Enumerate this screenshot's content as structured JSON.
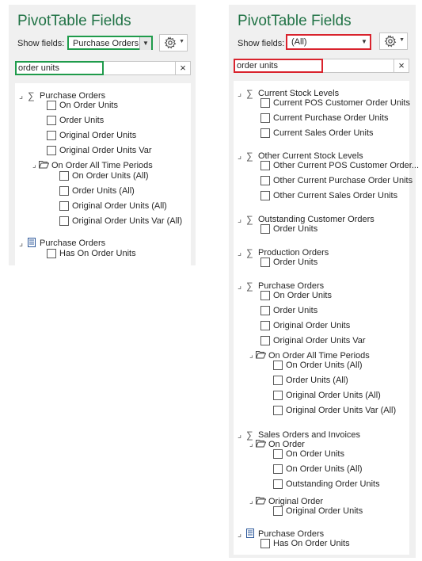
{
  "left": {
    "title": "PivotTable Fields",
    "show_fields_label": "Show fields:",
    "show_fields_value": "Purchase Orders",
    "highlight_color": "#1f9b4b",
    "search_value": "order units",
    "clear_label": "×",
    "tree": [
      {
        "type": "group",
        "icon": "sigma-icon",
        "label": "Purchase Orders"
      },
      {
        "type": "field",
        "label": "On Order Units"
      },
      {
        "type": "field",
        "label": "Order Units"
      },
      {
        "type": "field",
        "label": "Original Order Units"
      },
      {
        "type": "field",
        "label": "Original Order Units Var"
      },
      {
        "type": "folder",
        "icon": "folder-icon",
        "label": "On Order All Time Periods"
      },
      {
        "type": "field",
        "label": "On Order Units (All)"
      },
      {
        "type": "field",
        "label": "Order Units (All)"
      },
      {
        "type": "field",
        "label": "Original Order Units (All)"
      },
      {
        "type": "field",
        "label": "Original Order Units Var (All)"
      },
      {
        "type": "group",
        "icon": "table-icon",
        "label": "Purchase Orders"
      },
      {
        "type": "field",
        "label": "Has On Order Units"
      }
    ]
  },
  "right": {
    "title": "PivotTable Fields",
    "show_fields_label": "Show fields:",
    "show_fields_value": "(All)",
    "highlight_color": "#d9232d",
    "search_value": "order units",
    "clear_label": "×",
    "tree": [
      {
        "type": "group",
        "icon": "sigma-icon",
        "label": "Current Stock Levels"
      },
      {
        "type": "field",
        "label": "Current POS Customer Order Units"
      },
      {
        "type": "field",
        "label": "Current Purchase Order Units"
      },
      {
        "type": "field",
        "label": "Current Sales Order Units"
      },
      {
        "type": "group",
        "icon": "sigma-icon",
        "label": "Other Current Stock Levels"
      },
      {
        "type": "field",
        "label": "Other Current POS Customer Order..."
      },
      {
        "type": "field",
        "label": "Other Current Purchase Order Units"
      },
      {
        "type": "field",
        "label": "Other Current Sales Order Units"
      },
      {
        "type": "group",
        "icon": "sigma-icon",
        "label": "Outstanding Customer Orders"
      },
      {
        "type": "field",
        "label": "Order Units"
      },
      {
        "type": "group",
        "icon": "sigma-icon",
        "label": "Production Orders"
      },
      {
        "type": "field",
        "label": "Order Units"
      },
      {
        "type": "group",
        "icon": "sigma-icon",
        "label": "Purchase Orders"
      },
      {
        "type": "field",
        "label": "On Order Units"
      },
      {
        "type": "field",
        "label": "Order Units"
      },
      {
        "type": "field",
        "label": "Original Order Units"
      },
      {
        "type": "field",
        "label": "Original Order Units Var"
      },
      {
        "type": "folder",
        "icon": "folder-icon",
        "label": "On Order All Time Periods"
      },
      {
        "type": "field",
        "label": "On Order Units (All)"
      },
      {
        "type": "field",
        "label": "Order Units (All)"
      },
      {
        "type": "field",
        "label": "Original Order Units (All)"
      },
      {
        "type": "field",
        "label": "Original Order Units Var (All)"
      },
      {
        "type": "group",
        "icon": "sigma-icon",
        "label": "Sales Orders and Invoices"
      },
      {
        "type": "folder",
        "icon": "folder-icon",
        "label": "On Order"
      },
      {
        "type": "field",
        "label": "On Order Units"
      },
      {
        "type": "field",
        "label": "On Order Units (All)"
      },
      {
        "type": "field",
        "label": "Outstanding Order Units"
      },
      {
        "type": "folder",
        "icon": "folder-icon",
        "label": "Original Order"
      },
      {
        "type": "field",
        "label": "Original Order Units"
      },
      {
        "type": "group",
        "icon": "table-icon",
        "label": "Purchase Orders"
      },
      {
        "type": "field",
        "label": "Has On Order Units"
      }
    ]
  }
}
